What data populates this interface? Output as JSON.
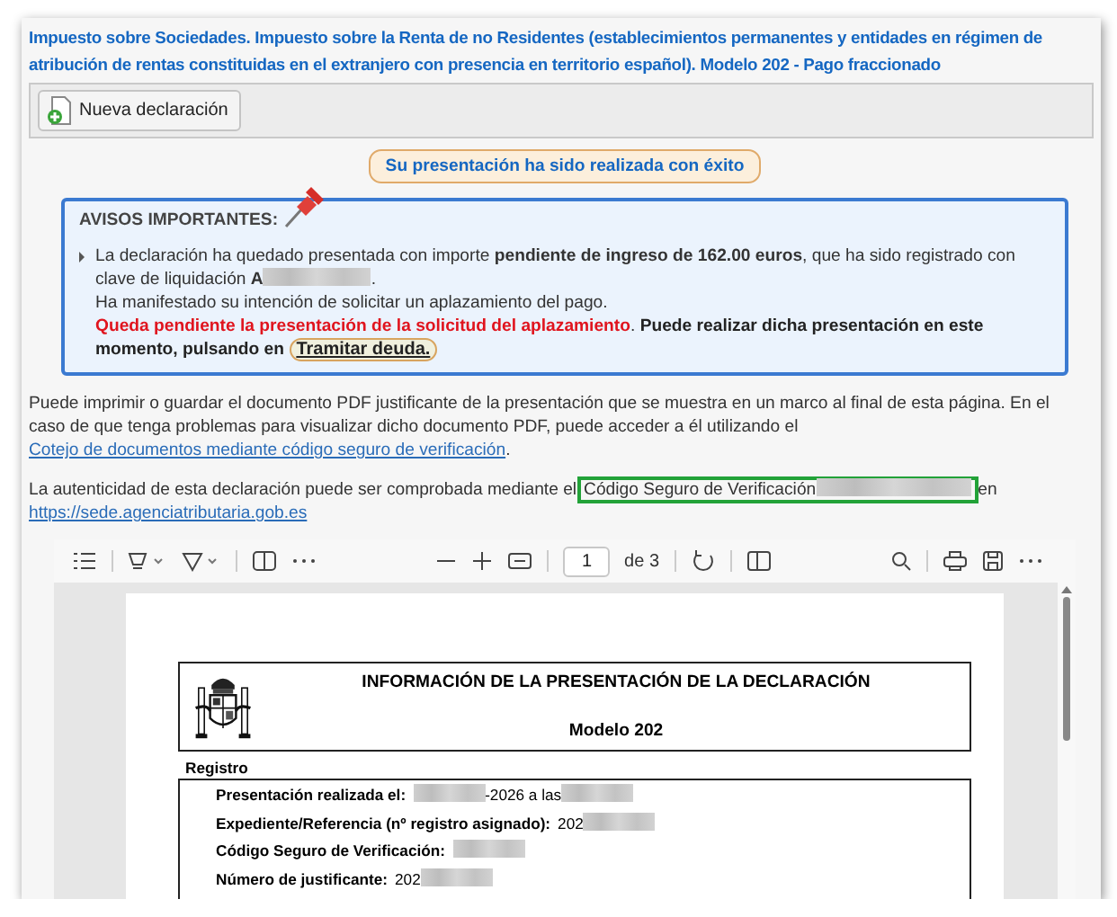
{
  "page": {
    "title": "Impuesto sobre Sociedades. Impuesto sobre la Renta de no Residentes (establecimientos permanentes y entidades en régimen de atribución de rentas constituidas en el extranjero con presencia en territorio español). Modelo 202 - Pago fraccionado"
  },
  "toolbar": {
    "new_button": "Nueva declaración"
  },
  "status_message": "Su presentación ha sido realizada con éxito",
  "notices": {
    "heading": "AVISOS IMPORTANTES:",
    "amount_text": "La declaración ha quedado presentada con importe **pendiente de ingreso de 162.00 euros**, que ha sido registrado con clave de liquidación **A**",
    "amount_end": ".",
    "deferral_text": "Ha manifestado su intención de solicitar un aplazamiento del pago.",
    "pending_warning": "Queda pendiente la presentación de la solicitud del aplazamiento",
    "warning_end": ".",
    "instruction": "Puede realizar dicha presentación en este momento, pulsando en",
    "action_link": "Tramitar deuda."
  },
  "info_paragraph": {
    "text": "Puede imprimir o guardar el documento PDF justificante de la presentación que se muestra en un marco al final de esta página. En el caso de que tenga problemas para visualizar dicho documento PDF, puede acceder a él utilizando el",
    "link": "Cotejo de documentos mediante código seguro de verificación",
    "end": "."
  },
  "verification": {
    "text": "La autenticidad de esta declaración puede ser comprobada mediante el",
    "code_label": "Código Seguro de Verificación",
    "after": "en",
    "url": "https://sede.agenciatributaria.gob.es"
  },
  "pdf_viewer": {
    "page_number": "1",
    "page_count": "de 3",
    "document": {
      "heading": "INFORMACIÓN DE LA PRESENTACIÓN DE LA DECLARACIÓN",
      "model": "Modelo 202",
      "section": "Registro",
      "fields": [
        {
          "label": "Presentación realizada el:",
          "value": [
            {
              "kind": "redacted"
            },
            {
              "kind": "text",
              "text": "-2026 a las"
            },
            {
              "kind": "redacted"
            }
          ]
        },
        {
          "label": "Expediente/Referencia (nº registro asignado):",
          "value": [
            {
              "kind": "text",
              "text": "202"
            },
            {
              "kind": "redacted"
            }
          ]
        },
        {
          "label": "Código Seguro de Verificación:",
          "value": [
            {
              "kind": "redacted"
            }
          ]
        },
        {
          "label": "Número de justificante:",
          "value": [
            {
              "kind": "text",
              "text": "202"
            },
            {
              "kind": "redacted"
            }
          ]
        }
      ]
    }
  }
}
